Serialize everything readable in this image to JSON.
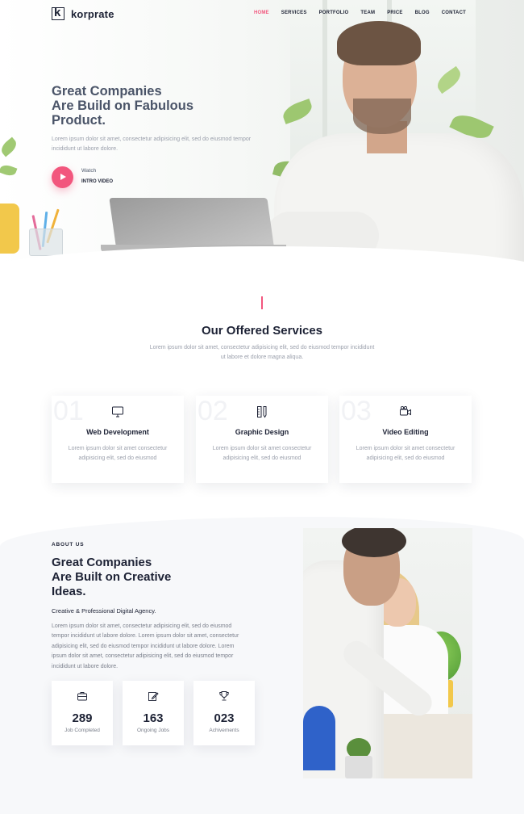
{
  "brand": {
    "logo_letter": "k",
    "name": "korprate"
  },
  "nav": {
    "items": [
      {
        "label": "HOME",
        "active": true
      },
      {
        "label": "SERVICES",
        "active": false
      },
      {
        "label": "PORTFOLIO",
        "active": false
      },
      {
        "label": "TEAM",
        "active": false
      },
      {
        "label": "PRICE",
        "active": false
      },
      {
        "label": "BLOG",
        "active": false
      },
      {
        "label": "CONTACT",
        "active": false
      }
    ]
  },
  "hero": {
    "title_lines": [
      "Great Companies",
      "Are Build on Fabulous",
      "Product."
    ],
    "description": "Lorem ipsum dolor sit amet, consectetur adipisicing elit, sed do eiusmod tempor incididunt ut labore dolore.",
    "watch_label": "Watch",
    "intro_label": "INTRO VIDEO"
  },
  "services": {
    "title": "Our Offered Services",
    "description": "Lorem ipsum dolor sit amet, consectetur adipisicing elit, sed do eiusmod tempor incididunt ut labore et dolore magna aliqua.",
    "cards": [
      {
        "number": "01",
        "icon": "monitor-icon",
        "title": "Web Development",
        "text": "Lorem ipsum dolor sit amet consectetur adipisicing elit, sed do eiusmod"
      },
      {
        "number": "02",
        "icon": "design-tools-icon",
        "title": "Graphic Design",
        "text": "Lorem ipsum dolor sit amet consectetur adipisicing elit, sed do eiusmod"
      },
      {
        "number": "03",
        "icon": "video-camera-icon",
        "title": "Video Editing",
        "text": "Lorem ipsum dolor sit amet consectetur adipisicing elit, sed do eiusmod"
      }
    ]
  },
  "about": {
    "label": "ABOUT US",
    "title_lines": [
      "Great Companies",
      "Are Built on Creative",
      "Ideas."
    ],
    "subtitle": "Creative & Professional Digital Agency.",
    "description": "Lorem ipsum dolor sit amet, consectetur adipisicing elit, sed do eiusmod tempor incididunt ut labore dolore. Lorem ipsum dolor sit amet, consectetur adipisicing elit, sed do eiusmod tempor incididunt ut labore dolore. Lorem ipsum dolor sit amet, consectetur adipisicing elit, sed do eiusmod tempor incididunt ut labore dolore.",
    "stats": [
      {
        "icon": "briefcase-icon",
        "value": "289",
        "label": "Job Completed"
      },
      {
        "icon": "edit-icon",
        "value": "163",
        "label": "Ongoing Jobs"
      },
      {
        "icon": "trophy-icon",
        "value": "023",
        "label": "Achivements"
      }
    ]
  },
  "colors": {
    "accent": "#f2567d",
    "heading": "#1d2235",
    "hero_heading": "#4a5468",
    "muted_text": "#9a9fab"
  }
}
